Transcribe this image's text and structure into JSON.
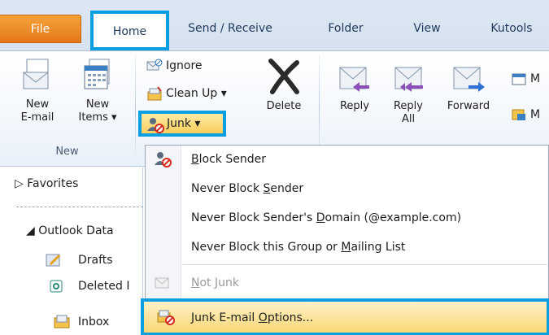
{
  "tabs": {
    "file": "File",
    "home": "Home",
    "send_receive": "Send / Receive",
    "folder": "Folder",
    "view": "View",
    "kutools": "Kutools"
  },
  "ribbon": {
    "new_email": {
      "line1": "New",
      "line2": "E-mail"
    },
    "new_items": {
      "line1": "New",
      "line2": "Items ▾"
    },
    "group_new_label": "New",
    "ignore": "Ignore",
    "clean_up": "Clean Up ▾",
    "junk": "Junk ▾",
    "delete": "Delete",
    "reply": "Reply",
    "reply_all": {
      "line1": "Reply",
      "line2": "All"
    },
    "forward": "Forward",
    "cut_label_top": "M",
    "cut_label_bottom": "M"
  },
  "nav": {
    "favorites": "▷ Favorites",
    "outlook_data": "◢ Outlook Data",
    "drafts": "Drafts",
    "deleted": "Deleted I",
    "inbox": "Inbox"
  },
  "menu": {
    "block_sender": {
      "pre": "",
      "u": "B",
      "post": "lock Sender"
    },
    "never_block_sender": {
      "pre": "Never Block ",
      "u": "S",
      "post": "ender"
    },
    "never_block_domain": {
      "pre": "Never Block Sender's ",
      "u": "D",
      "post": "omain (@example.com)"
    },
    "never_block_group": {
      "pre": "Never Block this Group or ",
      "u": "M",
      "post": "ailing List"
    },
    "not_junk": {
      "pre": "",
      "u": "N",
      "post": "ot Junk"
    },
    "junk_options": {
      "pre": "Junk E-mail ",
      "u": "O",
      "post": "ptions..."
    }
  },
  "colors": {
    "highlight_border": "#0a9fe0",
    "file_tab": "#e4781a",
    "menu_hover": "#f8d776"
  }
}
